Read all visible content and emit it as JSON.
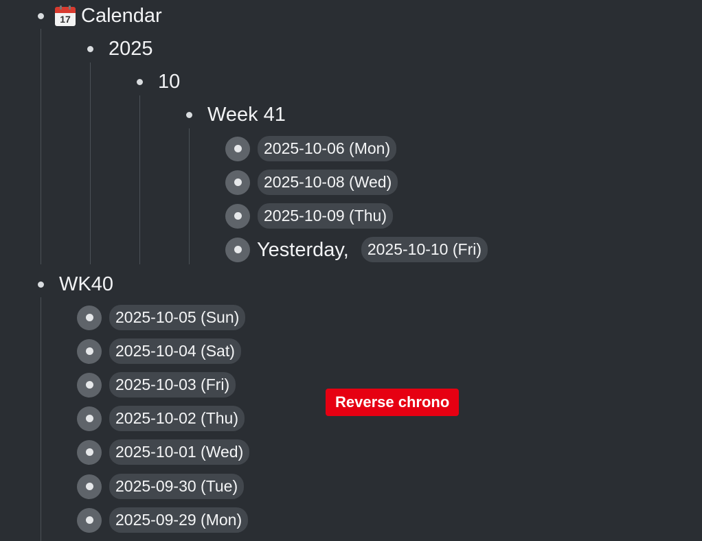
{
  "calendar": {
    "icon": "calendar-emoji-icon",
    "title": "Calendar",
    "year": {
      "title": "2025",
      "month": {
        "title": "10",
        "week": {
          "title": "Week 41",
          "days": [
            {
              "label": "2025-10-06 (Mon)"
            },
            {
              "label": "2025-10-08 (Wed)"
            },
            {
              "label": "2025-10-09 (Thu)"
            }
          ],
          "last": {
            "prefix": "Yesterday,",
            "label": "2025-10-10 (Fri)"
          }
        }
      }
    }
  },
  "wk40": {
    "title": "WK40",
    "days": [
      {
        "label": "2025-10-05 (Sun)"
      },
      {
        "label": "2025-10-04 (Sat)"
      },
      {
        "label": "2025-10-03 (Fri)"
      },
      {
        "label": "2025-10-02 (Thu)"
      },
      {
        "label": "2025-10-01 (Wed)"
      },
      {
        "label": "2025-09-30 (Tue)"
      },
      {
        "label": "2025-09-29 (Mon)"
      }
    ]
  },
  "annotation": {
    "text": "Reverse chrono",
    "color": "#e60012"
  }
}
